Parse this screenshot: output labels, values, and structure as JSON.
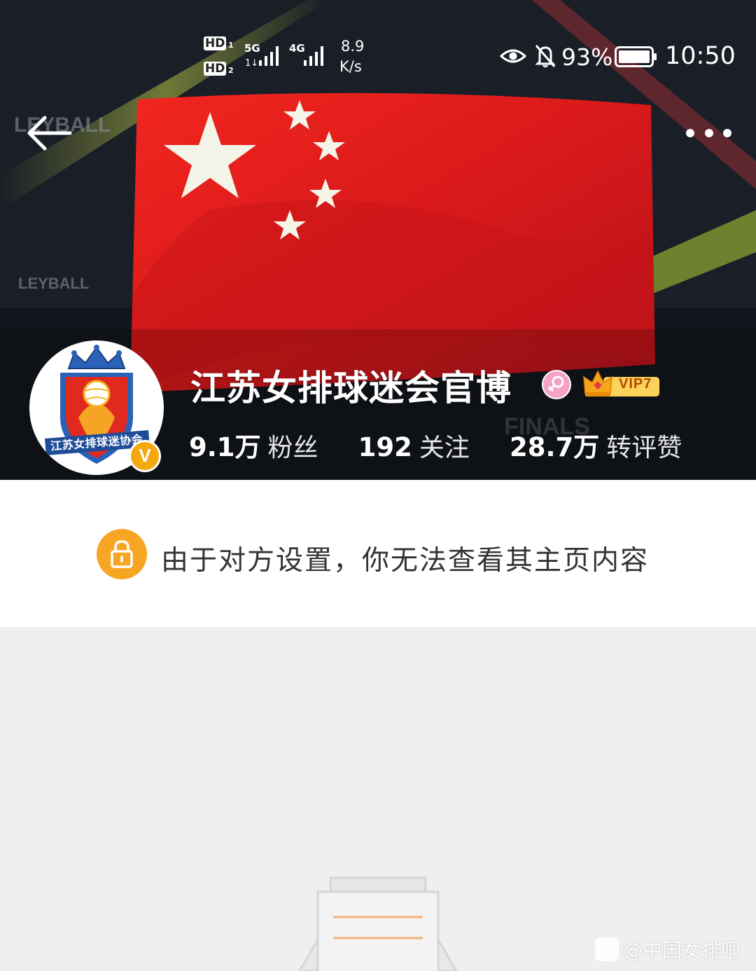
{
  "status_bar": {
    "sim1": "HD",
    "sim1_index": "1",
    "sim2": "HD",
    "sim2_index": "2",
    "net1": "5G",
    "net2": "4G",
    "speed_value": "8.9",
    "speed_unit": "K/s",
    "battery": "93%",
    "time": "10:50"
  },
  "profile": {
    "name": "江苏女排球迷会官博",
    "avatar_text": "江苏女排球迷协会",
    "verified_mark": "V",
    "vip_label": "VIP7",
    "stats": [
      {
        "value": "9.1万",
        "label": "粉丝"
      },
      {
        "value": "192",
        "label": "关注"
      },
      {
        "value": "28.7万",
        "label": "转评赞"
      }
    ]
  },
  "privacy_notice": "由于对方设置，你无法查看其主页内容",
  "watermark": "@中国女排吧",
  "colors": {
    "accent_orange": "#f6a623",
    "flag_red": "#e0201e",
    "star_color": "#f4f4e8"
  }
}
